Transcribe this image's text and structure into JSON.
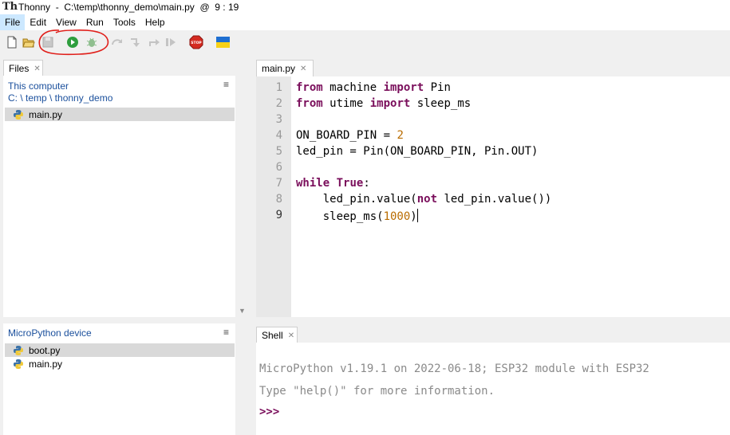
{
  "window": {
    "app_name": "Thonny",
    "title": "Thonny  -  C:\\temp\\thonny_demo\\main.py  @  9 : 19"
  },
  "menu": [
    "File",
    "Edit",
    "View",
    "Run",
    "Tools",
    "Help"
  ],
  "toolbar": {
    "icons": [
      "new-file-icon",
      "open-file-icon",
      "save-icon",
      "run-icon",
      "debug-icon",
      "step-over-icon",
      "step-into-icon",
      "step-out-icon",
      "resume-icon",
      "stop-icon",
      "ukraine-flag-icon"
    ],
    "stop_label": "STOP"
  },
  "files_panel": {
    "tab_label": "Files",
    "this_computer": {
      "header": "This computer",
      "path": "C: \\ temp \\ thonny_demo",
      "files": [
        {
          "name": "main.py",
          "selected": true
        }
      ]
    },
    "device": {
      "header": "MicroPython device",
      "files": [
        {
          "name": "boot.py",
          "selected": true
        },
        {
          "name": "main.py",
          "selected": false
        }
      ]
    }
  },
  "editor": {
    "tab_label": "main.py",
    "current_line": 9,
    "lines": [
      {
        "n": "1",
        "text": "from machine import Pin"
      },
      {
        "n": "2",
        "text": "from utime import sleep_ms"
      },
      {
        "n": "3",
        "text": ""
      },
      {
        "n": "4",
        "text": "ON_BOARD_PIN = 2"
      },
      {
        "n": "5",
        "text": "led_pin = Pin(ON_BOARD_PIN, Pin.OUT)"
      },
      {
        "n": "6",
        "text": ""
      },
      {
        "n": "7",
        "text": "while True:"
      },
      {
        "n": "8",
        "text": "    led_pin.value(not led_pin.value())"
      },
      {
        "n": "9",
        "text": "    sleep_ms(1000)"
      }
    ]
  },
  "shell": {
    "tab_label": "Shell",
    "lines": [
      "MicroPython v1.19.1 on 2022-06-18; ESP32 module with ESP32",
      "Type \"help()\" for more information."
    ],
    "prompt": ">>>"
  },
  "colors": {
    "keyword": "#7a0e5b",
    "number": "#b96c00",
    "folder_link": "#1a4f9c",
    "annotation_circle": "#e0201b"
  }
}
